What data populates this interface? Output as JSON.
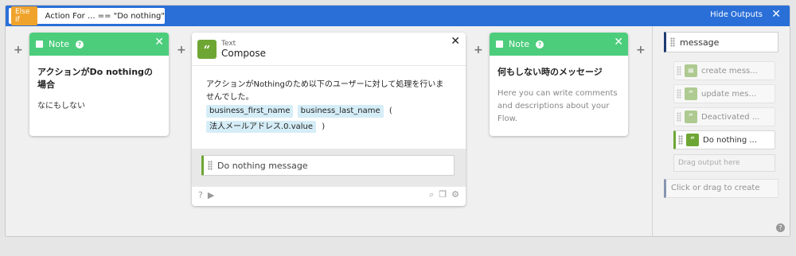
{
  "condition": {
    "badge": "Else if",
    "text": "Action For ...  ==  \"Do nothing\""
  },
  "toolbar": {
    "hide_outputs": "Hide Outputs",
    "close_icon": "close-icon"
  },
  "note1": {
    "header": "Note",
    "title": "アクションがDo nothingの場合",
    "text": "なにもしない"
  },
  "compose": {
    "subtitle": "Text",
    "title": "Compose",
    "body_text": "アクションがNothingのため以下のユーザーに対して処理を行いませんでした。",
    "tokens": [
      "business_first_name",
      "business_last_name"
    ],
    "open_paren": "(",
    "token3": "法人メールアドレス.0.value",
    "close_paren": ")",
    "output_name": "Do nothing message"
  },
  "note2": {
    "header": "Note",
    "title": "何もしない時のメッセージ",
    "text": "Here you can write comments and descriptions about your Flow."
  },
  "outputs": {
    "message": "message",
    "items": [
      {
        "label": "create mess...",
        "icon": "list-icon",
        "color": "#6ea634"
      },
      {
        "label": "update mes...",
        "icon": "quote-icon",
        "color": "#6ea634"
      },
      {
        "label": "Deactivated ...",
        "icon": "quote-icon",
        "color": "#6ea634"
      },
      {
        "label": "Do nothing ...",
        "icon": "quote-icon",
        "color": "#6ea634"
      }
    ],
    "drag_hint": "Drag output here",
    "create": "Click or drag to create"
  },
  "colors": {
    "topbar": "#2a6fd8",
    "note": "#4ccd7c",
    "compose": "#6ea634",
    "badge": "#f0a32b"
  }
}
